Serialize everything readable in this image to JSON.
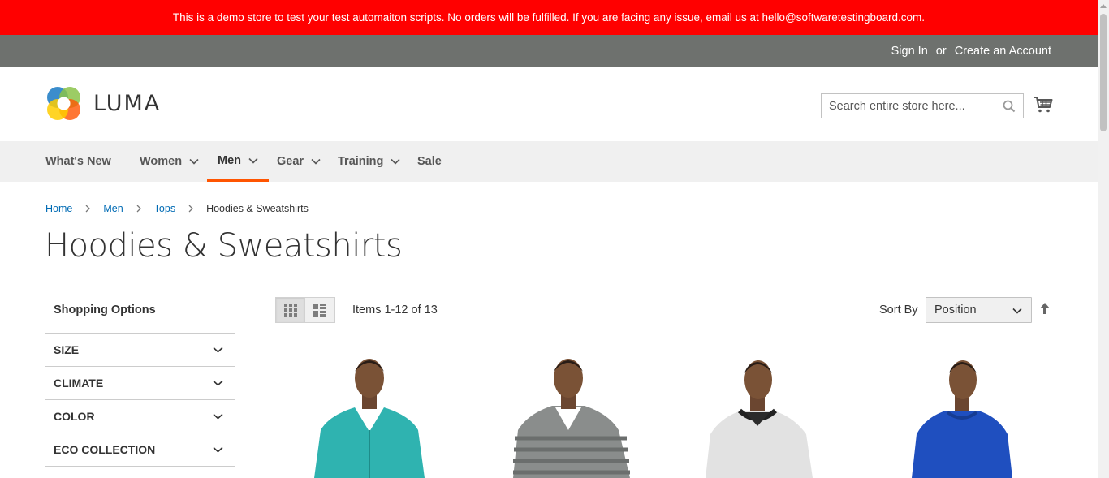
{
  "demo_notice": "This is a demo store to test your test automaiton scripts. No orders will be fulfilled. If you are facing any issue, email us at hello@softwaretestingboard.com.",
  "header_panel": {
    "sign_in": "Sign In",
    "or": "or",
    "create_account": "Create an Account"
  },
  "logo": {
    "text": "LUMA"
  },
  "search": {
    "placeholder": "Search entire store here..."
  },
  "nav": {
    "items": [
      {
        "label": "What's New"
      },
      {
        "label": "Women"
      },
      {
        "label": "Men"
      },
      {
        "label": "Gear"
      },
      {
        "label": "Training"
      },
      {
        "label": "Sale"
      }
    ],
    "active": "Men"
  },
  "breadcrumbs": {
    "items": [
      {
        "label": "Home"
      },
      {
        "label": "Men"
      },
      {
        "label": "Tops"
      },
      {
        "label": "Hoodies & Sweatshirts"
      }
    ]
  },
  "page_title": "Hoodies & Sweatshirts",
  "sidebar": {
    "title": "Shopping Options",
    "filters": [
      {
        "label": "SIZE"
      },
      {
        "label": "CLIMATE"
      },
      {
        "label": "COLOR"
      },
      {
        "label": "ECO COLLECTION"
      }
    ]
  },
  "toolbar": {
    "amount": "Items 1-12 of 13",
    "sort_label": "Sort By",
    "sort_value": "Position",
    "view_mode": "grid"
  },
  "products": [
    {
      "color": "#2fb3b0"
    },
    {
      "color": "#8a8d8c"
    },
    {
      "color": "#e2e2e2"
    },
    {
      "color": "#1f4fbf"
    }
  ],
  "colors": {
    "notice_bg": "#ff0000",
    "panel_bg": "#6e716e",
    "nav_bg": "#f0f0f0",
    "nav_active_border": "#ff5501",
    "link": "#006bb4"
  }
}
